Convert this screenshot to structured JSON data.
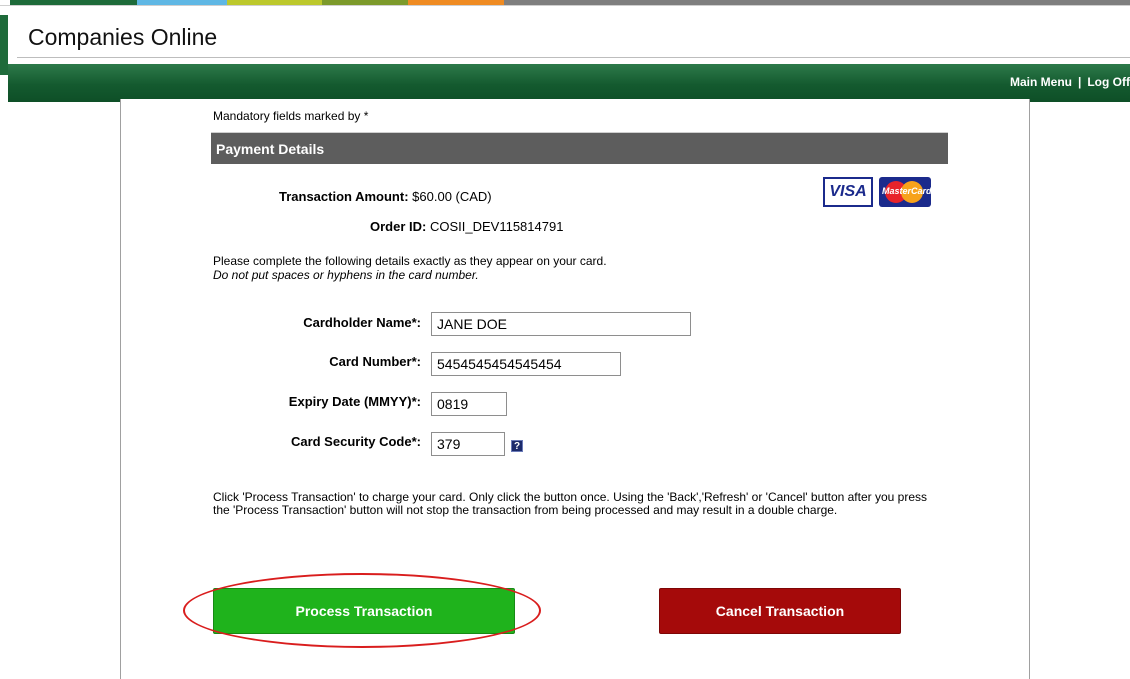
{
  "app": {
    "title": "Companies Online"
  },
  "nav": {
    "main_menu": "Main Menu",
    "separator": "|",
    "log_off": "Log Off"
  },
  "form": {
    "mandatory_note": "Mandatory fields marked by *",
    "section_title": "Payment Details",
    "transaction_amount_label": "Transaction Amount:",
    "transaction_amount_value": "$60.00 (CAD)",
    "order_id_label": "Order ID:",
    "order_id_value": "COSII_DEV115814791",
    "card_logos": {
      "visa": "VISA",
      "mastercard": "MasterCard"
    },
    "instructions_line1": "Please complete the following details exactly as they appear on your card.",
    "instructions_line2": "Do not put spaces or hyphens in the card number.",
    "cardholder_name_label": "Cardholder Name*:",
    "cardholder_name_value": "JANE DOE",
    "card_number_label": "Card Number*:",
    "card_number_value": "5454545454545454",
    "expiry_label": "Expiry Date (MMYY)*:",
    "expiry_value": "0819",
    "security_code_label": "Card Security Code*:",
    "security_code_value": "379",
    "help_icon_glyph": "?",
    "notice": "Click 'Process Transaction' to charge your card. Only click the button once. Using the 'Back','Refresh' or 'Cancel' button after you press the 'Process Transaction' button will not stop the transaction from being processed and may result in a double charge.",
    "process_button": "Process Transaction",
    "cancel_button": "Cancel Transaction"
  },
  "colors": {
    "brand_green": "#1e6b3a",
    "section_gray": "#5d5d5d",
    "process_green": "#1fb31c",
    "cancel_red": "#a50a0a",
    "highlight_red": "#d91d1d"
  }
}
